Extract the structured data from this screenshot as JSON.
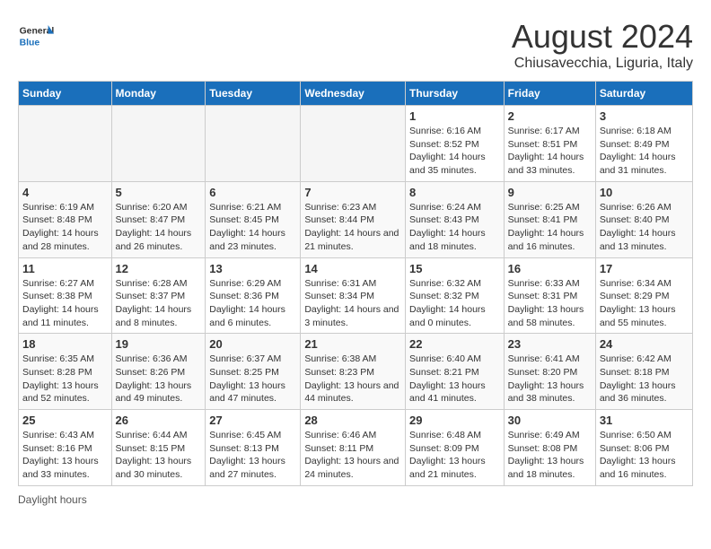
{
  "header": {
    "logo_general": "General",
    "logo_blue": "Blue",
    "title": "August 2024",
    "subtitle": "Chiusavecchia, Liguria, Italy"
  },
  "days_of_week": [
    "Sunday",
    "Monday",
    "Tuesday",
    "Wednesday",
    "Thursday",
    "Friday",
    "Saturday"
  ],
  "weeks": [
    [
      {
        "day": "",
        "empty": true
      },
      {
        "day": "",
        "empty": true
      },
      {
        "day": "",
        "empty": true
      },
      {
        "day": "",
        "empty": true
      },
      {
        "day": "1",
        "sunrise": "6:16 AM",
        "sunset": "8:52 PM",
        "daylight": "14 hours and 35 minutes."
      },
      {
        "day": "2",
        "sunrise": "6:17 AM",
        "sunset": "8:51 PM",
        "daylight": "14 hours and 33 minutes."
      },
      {
        "day": "3",
        "sunrise": "6:18 AM",
        "sunset": "8:49 PM",
        "daylight": "14 hours and 31 minutes."
      }
    ],
    [
      {
        "day": "4",
        "sunrise": "6:19 AM",
        "sunset": "8:48 PM",
        "daylight": "14 hours and 28 minutes."
      },
      {
        "day": "5",
        "sunrise": "6:20 AM",
        "sunset": "8:47 PM",
        "daylight": "14 hours and 26 minutes."
      },
      {
        "day": "6",
        "sunrise": "6:21 AM",
        "sunset": "8:45 PM",
        "daylight": "14 hours and 23 minutes."
      },
      {
        "day": "7",
        "sunrise": "6:23 AM",
        "sunset": "8:44 PM",
        "daylight": "14 hours and 21 minutes."
      },
      {
        "day": "8",
        "sunrise": "6:24 AM",
        "sunset": "8:43 PM",
        "daylight": "14 hours and 18 minutes."
      },
      {
        "day": "9",
        "sunrise": "6:25 AM",
        "sunset": "8:41 PM",
        "daylight": "14 hours and 16 minutes."
      },
      {
        "day": "10",
        "sunrise": "6:26 AM",
        "sunset": "8:40 PM",
        "daylight": "14 hours and 13 minutes."
      }
    ],
    [
      {
        "day": "11",
        "sunrise": "6:27 AM",
        "sunset": "8:38 PM",
        "daylight": "14 hours and 11 minutes."
      },
      {
        "day": "12",
        "sunrise": "6:28 AM",
        "sunset": "8:37 PM",
        "daylight": "14 hours and 8 minutes."
      },
      {
        "day": "13",
        "sunrise": "6:29 AM",
        "sunset": "8:36 PM",
        "daylight": "14 hours and 6 minutes."
      },
      {
        "day": "14",
        "sunrise": "6:31 AM",
        "sunset": "8:34 PM",
        "daylight": "14 hours and 3 minutes."
      },
      {
        "day": "15",
        "sunrise": "6:32 AM",
        "sunset": "8:32 PM",
        "daylight": "14 hours and 0 minutes."
      },
      {
        "day": "16",
        "sunrise": "6:33 AM",
        "sunset": "8:31 PM",
        "daylight": "13 hours and 58 minutes."
      },
      {
        "day": "17",
        "sunrise": "6:34 AM",
        "sunset": "8:29 PM",
        "daylight": "13 hours and 55 minutes."
      }
    ],
    [
      {
        "day": "18",
        "sunrise": "6:35 AM",
        "sunset": "8:28 PM",
        "daylight": "13 hours and 52 minutes."
      },
      {
        "day": "19",
        "sunrise": "6:36 AM",
        "sunset": "8:26 PM",
        "daylight": "13 hours and 49 minutes."
      },
      {
        "day": "20",
        "sunrise": "6:37 AM",
        "sunset": "8:25 PM",
        "daylight": "13 hours and 47 minutes."
      },
      {
        "day": "21",
        "sunrise": "6:38 AM",
        "sunset": "8:23 PM",
        "daylight": "13 hours and 44 minutes."
      },
      {
        "day": "22",
        "sunrise": "6:40 AM",
        "sunset": "8:21 PM",
        "daylight": "13 hours and 41 minutes."
      },
      {
        "day": "23",
        "sunrise": "6:41 AM",
        "sunset": "8:20 PM",
        "daylight": "13 hours and 38 minutes."
      },
      {
        "day": "24",
        "sunrise": "6:42 AM",
        "sunset": "8:18 PM",
        "daylight": "13 hours and 36 minutes."
      }
    ],
    [
      {
        "day": "25",
        "sunrise": "6:43 AM",
        "sunset": "8:16 PM",
        "daylight": "13 hours and 33 minutes."
      },
      {
        "day": "26",
        "sunrise": "6:44 AM",
        "sunset": "8:15 PM",
        "daylight": "13 hours and 30 minutes."
      },
      {
        "day": "27",
        "sunrise": "6:45 AM",
        "sunset": "8:13 PM",
        "daylight": "13 hours and 27 minutes."
      },
      {
        "day": "28",
        "sunrise": "6:46 AM",
        "sunset": "8:11 PM",
        "daylight": "13 hours and 24 minutes."
      },
      {
        "day": "29",
        "sunrise": "6:48 AM",
        "sunset": "8:09 PM",
        "daylight": "13 hours and 21 minutes."
      },
      {
        "day": "30",
        "sunrise": "6:49 AM",
        "sunset": "8:08 PM",
        "daylight": "13 hours and 18 minutes."
      },
      {
        "day": "31",
        "sunrise": "6:50 AM",
        "sunset": "8:06 PM",
        "daylight": "13 hours and 16 minutes."
      }
    ]
  ],
  "footer": {
    "daylight_label": "Daylight hours"
  }
}
